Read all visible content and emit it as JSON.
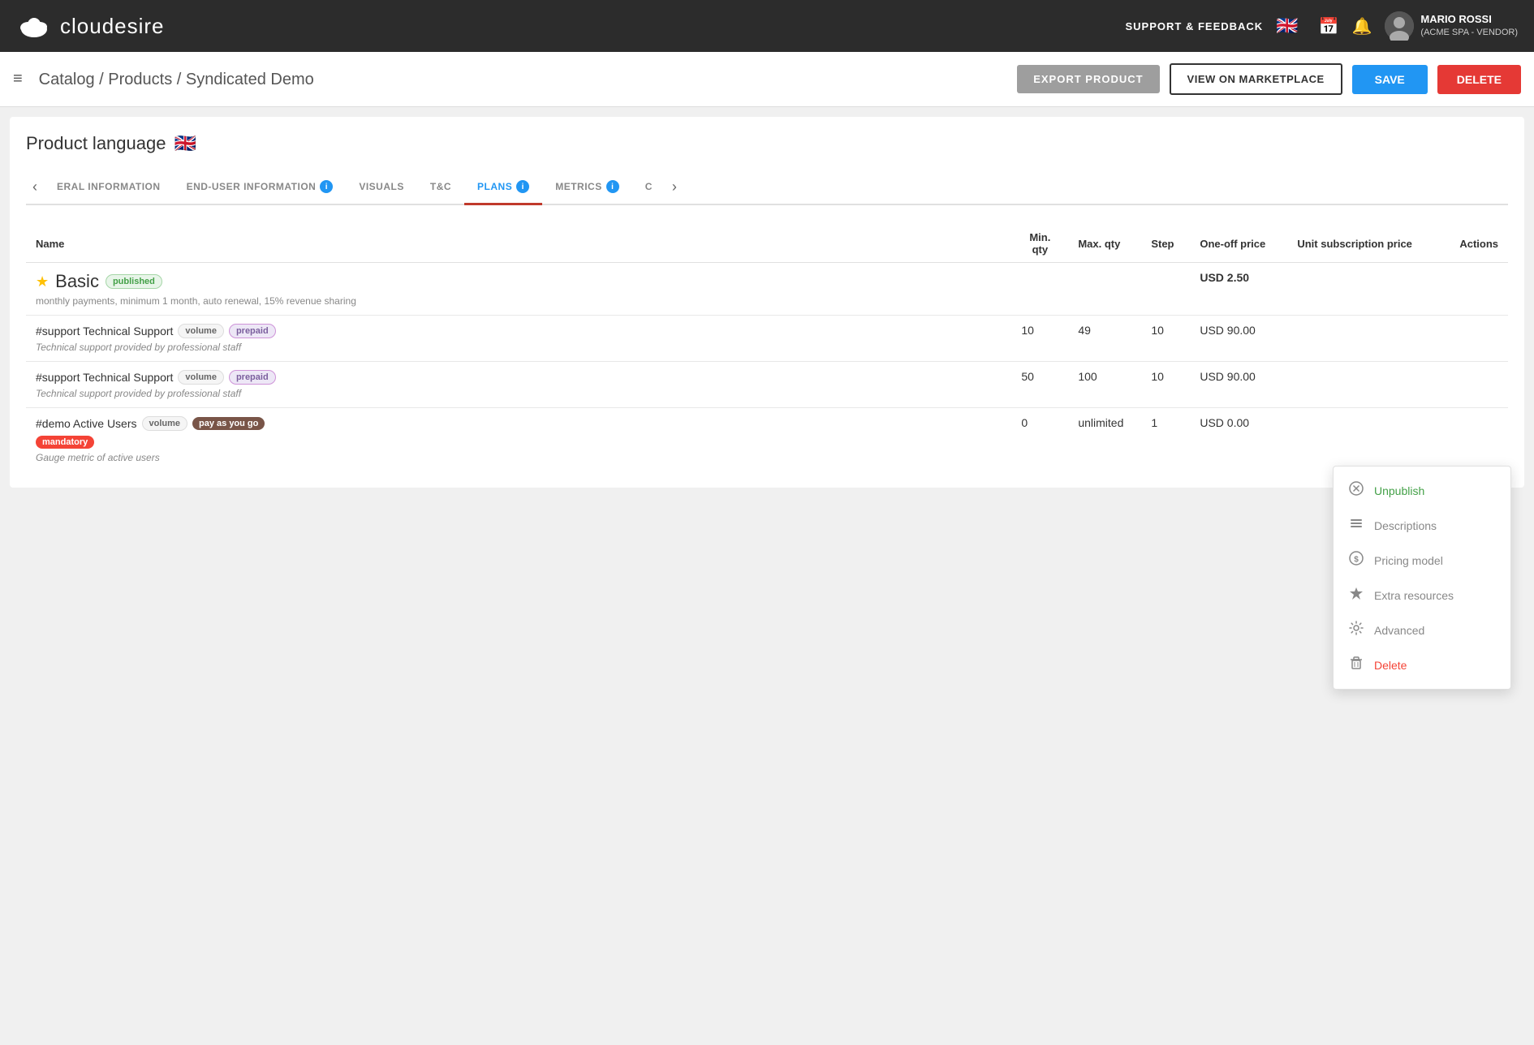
{
  "app": {
    "logo_text": "cloudesire",
    "nav_center_label": "SUPPORT & FEEDBACK",
    "user_name": "MARIO ROSSI",
    "user_sub": "(ACME SPA - VENDOR)"
  },
  "subnav": {
    "hamburger_label": "≡",
    "breadcrumb": "Catalog / Products / Syndicated Demo",
    "export_label": "EXPORT PRODUCT",
    "view_label": "VIEW ON MARKETPLACE",
    "save_label": "SAVE",
    "delete_label": "DELETE"
  },
  "product_language": {
    "label": "Product language"
  },
  "tabs": [
    {
      "id": "general",
      "label": "ERAL INFORMATION",
      "active": false,
      "info": false
    },
    {
      "id": "enduser",
      "label": "END-USER INFORMATION",
      "active": false,
      "info": true
    },
    {
      "id": "visuals",
      "label": "VISUALS",
      "active": false,
      "info": false
    },
    {
      "id": "tc",
      "label": "T&C",
      "active": false,
      "info": false
    },
    {
      "id": "plans",
      "label": "PLANS",
      "active": true,
      "info": true
    },
    {
      "id": "metrics",
      "label": "METRICS",
      "active": false,
      "info": true
    },
    {
      "id": "extra",
      "label": "C",
      "active": false,
      "info": false
    }
  ],
  "table": {
    "headers": {
      "name": "Name",
      "min_qty": "Min. qty",
      "max_qty": "Max. qty",
      "step": "Step",
      "one_off": "One-off price",
      "unit_sub": "Unit subscription price",
      "actions": "Actions"
    },
    "rows": [
      {
        "id": "basic",
        "star": true,
        "name": "Basic",
        "badge1": "published",
        "badge1_type": "published",
        "desc": "monthly payments, minimum 1 month, auto renewal, 15% revenue sharing",
        "min_qty": "",
        "max_qty": "",
        "step": "",
        "one_off": "USD 2.50",
        "unit_sub": ""
      },
      {
        "id": "support1",
        "star": false,
        "name": "#support Technical Support",
        "badge1": "volume",
        "badge1_type": "volume",
        "badge2": "prepaid",
        "badge2_type": "prepaid",
        "desc": "Technical support provided by professional staff",
        "min_qty": "10",
        "max_qty": "49",
        "step": "10",
        "one_off": "USD 90.00",
        "unit_sub": ""
      },
      {
        "id": "support2",
        "star": false,
        "name": "#support Technical Support",
        "badge1": "volume",
        "badge1_type": "volume",
        "badge2": "prepaid",
        "badge2_type": "prepaid",
        "desc": "Technical support provided by professional staff",
        "min_qty": "50",
        "max_qty": "100",
        "step": "10",
        "one_off": "USD 90.00",
        "unit_sub": ""
      },
      {
        "id": "demo",
        "star": false,
        "name": "#demo Active Users",
        "badge1": "volume",
        "badge1_type": "volume",
        "badge2": "pay as you go",
        "badge2_type": "payasyougo",
        "badge3": "mandatory",
        "badge3_type": "mandatory",
        "desc": "Gauge metric of active users",
        "min_qty": "0",
        "max_qty": "unlimited",
        "step": "1",
        "one_off": "USD 0.00",
        "unit_sub": ""
      }
    ]
  },
  "dropdown": {
    "items": [
      {
        "id": "unpublish",
        "icon": "✖",
        "label": "Unpublish",
        "color": "green",
        "icon_type": "circle-x"
      },
      {
        "id": "descriptions",
        "icon": "≡",
        "label": "Descriptions",
        "color": "normal",
        "icon_type": "list"
      },
      {
        "id": "pricing",
        "icon": "$",
        "label": "Pricing model",
        "color": "normal",
        "icon_type": "dollar-circle"
      },
      {
        "id": "extra",
        "icon": "★",
        "label": "Extra resources",
        "color": "normal",
        "icon_type": "star"
      },
      {
        "id": "advanced",
        "icon": "⚙",
        "label": "Advanced",
        "color": "normal",
        "icon_type": "gear"
      },
      {
        "id": "delete",
        "icon": "🗑",
        "label": "Delete",
        "color": "red",
        "icon_type": "trash"
      }
    ]
  }
}
